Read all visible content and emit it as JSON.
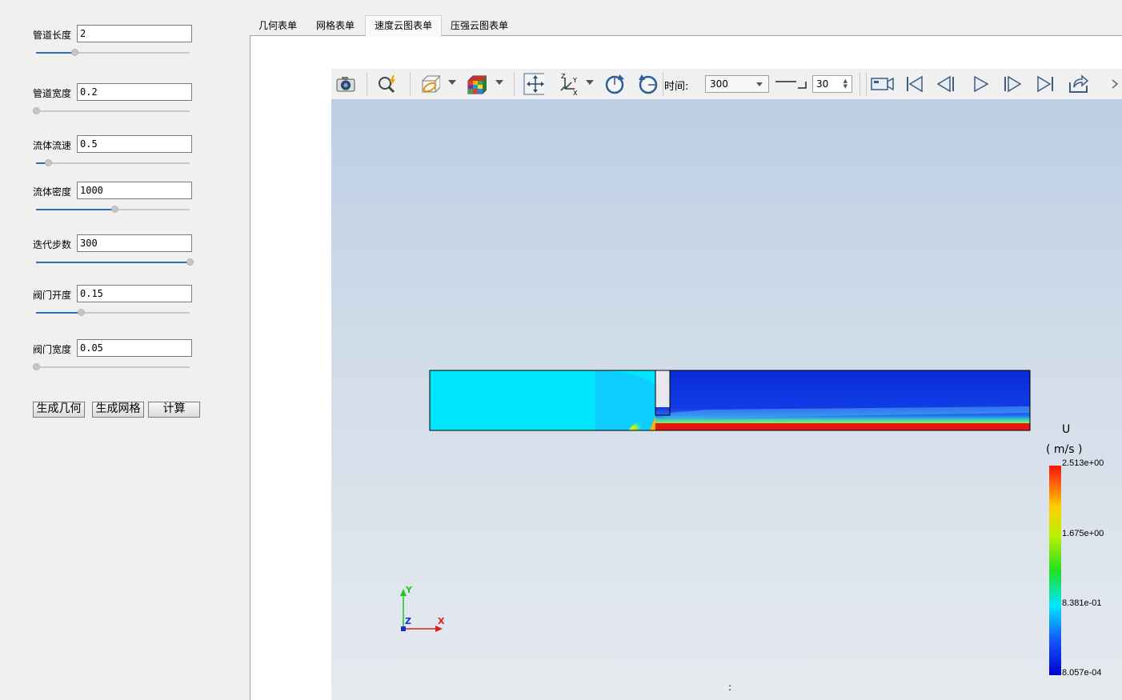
{
  "params": [
    {
      "label": "管道长度",
      "value": "2",
      "slider": 0.25
    },
    {
      "label": "管道宽度",
      "value": "0.2",
      "slider": 0.0
    },
    {
      "label": "流体流速",
      "value": "0.5",
      "slider": 0.08
    },
    {
      "label": "流体密度",
      "value": "1000",
      "slider": 0.51
    },
    {
      "label": "迭代步数",
      "value": "300",
      "slider": 1.0
    },
    {
      "label": "阀门开度",
      "value": "0.15",
      "slider": 0.29
    },
    {
      "label": "阀门宽度",
      "value": "0.05",
      "slider": 0.0
    }
  ],
  "buttons": {
    "gen_geometry": "生成几何",
    "gen_mesh": "生成网格",
    "compute": "计算"
  },
  "tabs": [
    "几何表单",
    "网格表单",
    "速度云图表单",
    "压强云图表单"
  ],
  "active_tab": "速度云图表单",
  "toolbar": {
    "time_label": "时间:",
    "time_value": "300",
    "step_value": "30",
    "icons": [
      "camera-icon",
      "zoom-icon",
      "clip-icon",
      "color-cube-icon",
      "reset-view-icon",
      "axes-orient-icon",
      "rotate-cw-icon",
      "rotate-ccw-icon",
      "record-icon",
      "first-frame-icon",
      "prev-frame-icon",
      "play-icon",
      "next-frame-icon",
      "last-frame-icon",
      "export-icon"
    ]
  },
  "colorbar": {
    "title": "U",
    "unit": "( m/s )",
    "ticks": [
      "2.513e+00",
      "1.675e+00",
      "8.381e-01",
      "8.057e-04"
    ]
  },
  "axes": {
    "y": "Y",
    "z": "Z",
    "x": "X"
  },
  "status_mark": ":",
  "colors": {
    "slider_fill": "#2a6fb9",
    "background_top": "#bccfe4",
    "background_bottom": "#e6eaef"
  }
}
